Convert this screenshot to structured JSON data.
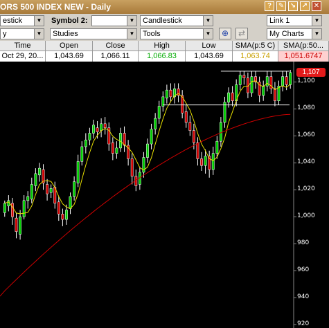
{
  "window": {
    "title": "ORS 500 INDEX NEW - Daily",
    "buttons": [
      "?",
      "✎",
      "↘",
      "↗",
      "✕"
    ]
  },
  "toolbar1": {
    "combo1": "estick",
    "symbol2_label": "Symbol 2:",
    "symbol2_value": "",
    "chart_type": "Candlestick",
    "layout": "Link 1"
  },
  "toolbar2": {
    "combo1": "y",
    "studies": "Studies",
    "tools": "Tools",
    "my_charts": "My Charts"
  },
  "table": {
    "headers": [
      "Time",
      "Open",
      "Close",
      "High",
      "Low",
      "SMA(p:5 C)",
      "SMA(p:50..."
    ],
    "row": [
      "Oct 29, 20...",
      "1,043.69",
      "1,066.11",
      "1,066.83",
      "1,043.69",
      "1,063.74",
      "1,051.6747"
    ],
    "colors": [
      "#000000",
      "#000000",
      "#000000",
      "#00aa00",
      "#000000",
      "#c8a000",
      "#cc0000"
    ]
  },
  "chart_data": {
    "type": "candlestick",
    "y_ticks": [
      "1,100",
      "1,080",
      "1,060",
      "1,040",
      "1,020",
      "1,000",
      "980",
      "960",
      "940",
      "920"
    ],
    "ylim": [
      920,
      1110
    ],
    "current_price_label": "1,107",
    "up_color": "#00cc00",
    "down_color": "#cc0000",
    "sma_short_color": "#e8e000",
    "sma_long_color": "#cc0000",
    "candles": [
      [
        1003,
        1010,
        1000,
        1012
      ],
      [
        1008,
        1012,
        1004,
        1016
      ],
      [
        1010,
        1000,
        994,
        1014
      ],
      [
        999,
        989,
        984,
        1003
      ],
      [
        987,
        1000,
        983,
        1005
      ],
      [
        1000,
        1012,
        998,
        1016
      ],
      [
        1012,
        1015,
        1006,
        1019
      ],
      [
        1013,
        1024,
        1010,
        1029
      ],
      [
        1023,
        1032,
        1019,
        1036
      ],
      [
        1031,
        1036,
        1026,
        1040
      ],
      [
        1035,
        1025,
        1020,
        1039
      ],
      [
        1024,
        1017,
        1012,
        1028
      ],
      [
        1018,
        1021,
        1014,
        1024
      ],
      [
        1022,
        1010,
        1006,
        1026
      ],
      [
        1011,
        1002,
        997,
        1015
      ],
      [
        1002,
        998,
        993,
        1006
      ],
      [
        998,
        1005,
        994,
        1009
      ],
      [
        1006,
        1015,
        1002,
        1018
      ],
      [
        1015,
        1026,
        1012,
        1030
      ],
      [
        1025,
        1041,
        1022,
        1046
      ],
      [
        1041,
        1052,
        1038,
        1056
      ],
      [
        1052,
        1057,
        1047,
        1062
      ],
      [
        1057,
        1062,
        1053,
        1066
      ],
      [
        1062,
        1068,
        1058,
        1072
      ],
      [
        1066,
        1063,
        1058,
        1071
      ],
      [
        1064,
        1069,
        1059,
        1073
      ],
      [
        1069,
        1066,
        1061,
        1074
      ],
      [
        1066,
        1054,
        1049,
        1070
      ],
      [
        1055,
        1047,
        1042,
        1059
      ],
      [
        1047,
        1051,
        1043,
        1056
      ],
      [
        1051,
        1062,
        1048,
        1066
      ],
      [
        1062,
        1053,
        1048,
        1067
      ],
      [
        1053,
        1043,
        1038,
        1057
      ],
      [
        1043,
        1030,
        1024,
        1047
      ],
      [
        1030,
        1023,
        1019,
        1035
      ],
      [
        1024,
        1033,
        1020,
        1037
      ],
      [
        1033,
        1044,
        1029,
        1048
      ],
      [
        1044,
        1054,
        1040,
        1058
      ],
      [
        1054,
        1065,
        1050,
        1069
      ],
      [
        1065,
        1073,
        1061,
        1077
      ],
      [
        1073,
        1082,
        1069,
        1086
      ],
      [
        1082,
        1089,
        1078,
        1093
      ],
      [
        1088,
        1094,
        1084,
        1098
      ],
      [
        1094,
        1089,
        1085,
        1099
      ],
      [
        1089,
        1095,
        1084,
        1099
      ],
      [
        1095,
        1090,
        1085,
        1099
      ],
      [
        1090,
        1077,
        1073,
        1094
      ],
      [
        1078,
        1070,
        1066,
        1083
      ],
      [
        1070,
        1064,
        1060,
        1075
      ],
      [
        1064,
        1055,
        1050,
        1069
      ],
      [
        1055,
        1043,
        1038,
        1059
      ],
      [
        1043,
        1038,
        1034,
        1048
      ],
      [
        1038,
        1045,
        1032,
        1050
      ],
      [
        1045,
        1035,
        1029,
        1049
      ],
      [
        1035,
        1047,
        1031,
        1052
      ],
      [
        1047,
        1056,
        1043,
        1060
      ],
      [
        1056,
        1070,
        1052,
        1074
      ],
      [
        1070,
        1085,
        1066,
        1089
      ],
      [
        1085,
        1092,
        1081,
        1096
      ],
      [
        1092,
        1086,
        1082,
        1097
      ],
      [
        1086,
        1098,
        1082,
        1102
      ],
      [
        1098,
        1105,
        1094,
        1108
      ],
      [
        1105,
        1103,
        1098,
        1108
      ],
      [
        1103,
        1092,
        1088,
        1107
      ],
      [
        1092,
        1104,
        1089,
        1108
      ],
      [
        1104,
        1100,
        1095,
        1108
      ],
      [
        1100,
        1090,
        1085,
        1104
      ],
      [
        1090,
        1097,
        1086,
        1101
      ],
      [
        1097,
        1104,
        1093,
        1108
      ],
      [
        1104,
        1095,
        1091,
        1108
      ],
      [
        1095,
        1086,
        1082,
        1100
      ],
      [
        1086,
        1097,
        1083,
        1101
      ],
      [
        1097,
        1104,
        1093,
        1108
      ],
      [
        1104,
        1098,
        1094,
        1108
      ],
      [
        1098,
        1107,
        1095,
        1109
      ]
    ]
  }
}
